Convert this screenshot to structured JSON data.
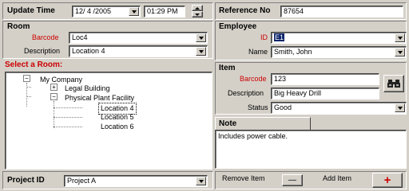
{
  "update_time": {
    "label": "Update Time",
    "date": "12/ 4 /2005",
    "time": "01:29 PM"
  },
  "reference": {
    "label": "Reference No",
    "value": "87654"
  },
  "room": {
    "heading": "Room",
    "barcode_label": "Barcode",
    "barcode_value": "Loc4",
    "description_label": "Description",
    "description_value": "Location 4"
  },
  "employee": {
    "heading": "Employee",
    "id_label": "ID",
    "id_value": "E1",
    "name_label": "Name",
    "name_value": "Smith, John"
  },
  "select_room": {
    "heading": "Select a Room:",
    "tree": [
      {
        "label": "My Company"
      },
      {
        "label": "Legal Building"
      },
      {
        "label": "Physical Plant Facility"
      },
      {
        "label": "Location 4"
      },
      {
        "label": "Location 5"
      },
      {
        "label": "Location 6"
      }
    ]
  },
  "item": {
    "heading": "Item",
    "barcode_label": "Barcode",
    "barcode_value": "123",
    "description_label": "Description",
    "description_value": "Big Heavy Drill",
    "status_label": "Status",
    "status_value": "Good"
  },
  "note": {
    "tab_label": "Note",
    "text": "Includes power cable."
  },
  "project": {
    "label": "Project ID",
    "value": "Project A"
  },
  "actions": {
    "remove_label": "Remove Item",
    "add_label": "Add Item",
    "remove_symbol": "—",
    "add_symbol": "+"
  },
  "colors": {
    "accent_red": "#cc0000",
    "selection": "#0a246a"
  }
}
